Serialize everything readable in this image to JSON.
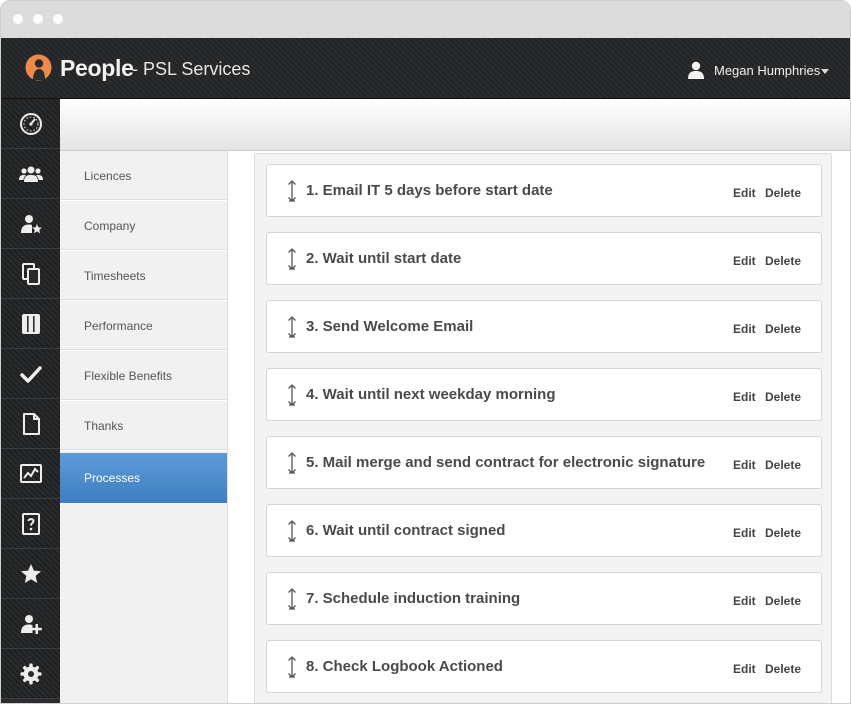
{
  "header": {
    "brand": "People",
    "company": "- PSL Services",
    "user_name": "Megan Humphries",
    "accent_color": "#f08a4b"
  },
  "iconbar": {
    "items": [
      {
        "icon": "dashboard-icon"
      },
      {
        "icon": "people-icon"
      },
      {
        "icon": "user-star-icon"
      },
      {
        "icon": "copy-documents-icon"
      },
      {
        "icon": "notebook-icon"
      },
      {
        "icon": "checkmark-icon"
      },
      {
        "icon": "document-icon"
      },
      {
        "icon": "chart-icon"
      },
      {
        "icon": "help-document-icon"
      },
      {
        "icon": "star-icon"
      },
      {
        "icon": "add-user-icon"
      },
      {
        "icon": "gear-icon"
      }
    ]
  },
  "menu": {
    "items": [
      {
        "label": "Licences"
      },
      {
        "label": "Company"
      },
      {
        "label": "Timesheets"
      },
      {
        "label": "Performance"
      },
      {
        "label": "Flexible Benefits"
      },
      {
        "label": "Thanks"
      },
      {
        "label": "Processes",
        "active": true
      }
    ],
    "active_color": "#4a8ccb"
  },
  "process": {
    "edit_label": "Edit",
    "delete_label": "Delete",
    "steps": [
      {
        "label": "1. Email IT 5 days before start date"
      },
      {
        "label": "2. Wait until start date"
      },
      {
        "label": "3. Send Welcome Email"
      },
      {
        "label": "4. Wait until next weekday morning"
      },
      {
        "label": "5. Mail merge and send contract for electronic signature"
      },
      {
        "label": "6. Wait until contract signed"
      },
      {
        "label": "7. Schedule induction training"
      },
      {
        "label": "8. Check Logbook Actioned"
      }
    ]
  }
}
